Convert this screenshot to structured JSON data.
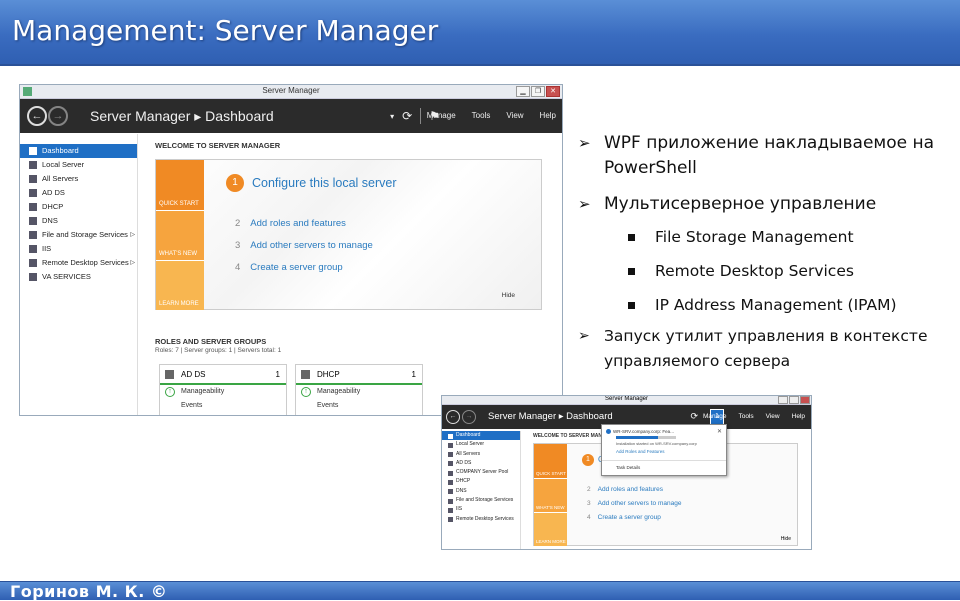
{
  "slide": {
    "title": "Management: Server Manager",
    "footer": "Горинов М. К. ©"
  },
  "window": {
    "title": "Server Manager",
    "breadcrumb": "Server Manager ▸ Dashboard",
    "menu": [
      "Manage",
      "Tools",
      "View",
      "Help"
    ],
    "sidebar": [
      {
        "label": "Dashboard",
        "icon": "dashboard-icon",
        "active": true
      },
      {
        "label": "Local Server",
        "icon": "server-icon"
      },
      {
        "label": "All Servers",
        "icon": "servers-icon"
      },
      {
        "label": "AD DS",
        "icon": "ad-ds-icon"
      },
      {
        "label": "DHCP",
        "icon": "dhcp-icon"
      },
      {
        "label": "DNS",
        "icon": "dns-icon"
      },
      {
        "label": "File and Storage Services",
        "icon": "storage-icon",
        "arrow": "▷"
      },
      {
        "label": "IIS",
        "icon": "iis-icon"
      },
      {
        "label": "Remote Desktop Services",
        "icon": "rds-icon",
        "arrow": "▷"
      },
      {
        "label": "VA SERVICES",
        "icon": "va-icon"
      }
    ],
    "welcome_title": "WELCOME TO SERVER MANAGER",
    "tabs": [
      "QUICK START",
      "WHAT'S NEW",
      "LEARN MORE"
    ],
    "step1": {
      "num": "1",
      "label": "Configure this local server"
    },
    "steps": [
      {
        "num": "2",
        "label": "Add roles and features"
      },
      {
        "num": "3",
        "label": "Add other servers to manage"
      },
      {
        "num": "4",
        "label": "Create a server group"
      }
    ],
    "hide": "Hide",
    "roles_title": "ROLES AND SERVER GROUPS",
    "roles_sub": "Roles: 7 | Server groups: 1 | Servers total: 1",
    "roles": [
      {
        "name": "AD DS",
        "count": "1",
        "line1": "Manageability",
        "line2": "Events"
      },
      {
        "name": "DHCP",
        "count": "1",
        "line1": "Manageability",
        "line2": "Events"
      }
    ]
  },
  "bullets": {
    "b1": "WPF приложение накладываемое на PowerShell",
    "b2": "Мультисерверное управление",
    "sub": [
      "File Storage Management",
      "Remote Desktop Services",
      "IP Address Management (IPAM)"
    ],
    "b3": "Запуск утилит управления в контексте управляемого сервера"
  },
  "window2": {
    "title": "Server Manager",
    "breadcrumb": "Server Manager ▸ Dashboard",
    "menu": [
      "Manage",
      "Tools",
      "View",
      "Help"
    ],
    "sidebar": [
      {
        "label": "Dashboard",
        "active": true
      },
      {
        "label": "Local Server"
      },
      {
        "label": "All Servers"
      },
      {
        "label": "AD DS"
      },
      {
        "label": "COMPANY Server Pool"
      },
      {
        "label": "DHCP"
      },
      {
        "label": "DNS"
      },
      {
        "label": "File and Storage Services"
      },
      {
        "label": "IIS"
      },
      {
        "label": "Remote Desktop Services"
      }
    ],
    "welcome_title": "WELCOME TO SERVER MANAGER",
    "tabs": [
      "QUICK START",
      "WHAT'S NEW",
      "LEARN MORE"
    ],
    "step1": {
      "num": "1",
      "label": "C"
    },
    "steps": [
      {
        "num": "2",
        "label": "Add roles and features"
      },
      {
        "num": "3",
        "label": "Add other servers to manage"
      },
      {
        "num": "4",
        "label": "Create a server group"
      }
    ],
    "hide": "Hide",
    "flag_count": "1",
    "notification": {
      "server": "WR-SRV.company.corp: Fea...",
      "message": "Installation started on WR-SRV.company.corp",
      "link": "Add Roles and Features",
      "task": "Task Details",
      "progress": 0.7
    }
  }
}
